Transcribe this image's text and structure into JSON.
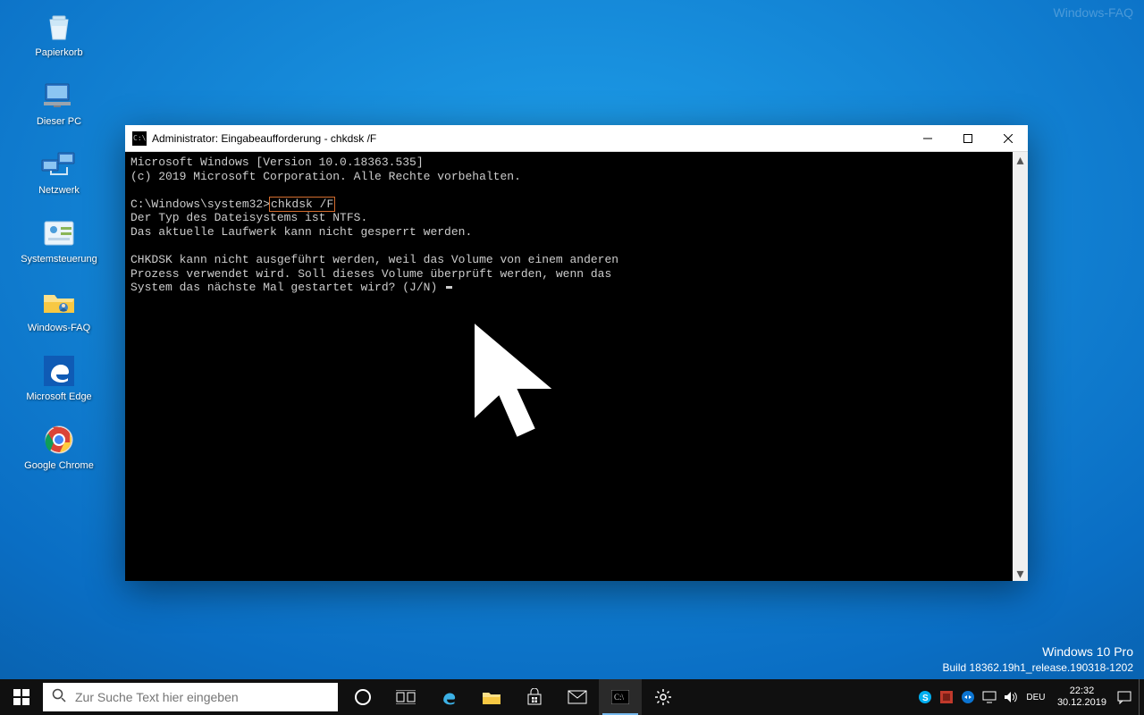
{
  "watermark_top": "Windows-FAQ",
  "watermark_line1": "Windows 10 Pro",
  "watermark_line2": "Build 18362.19h1_release.190318-1202",
  "desktop_icons": [
    {
      "id": "recycle",
      "label": "Papierkorb"
    },
    {
      "id": "pc",
      "label": "Dieser PC"
    },
    {
      "id": "net",
      "label": "Netzwerk"
    },
    {
      "id": "cpl",
      "label": "Systemsteuerung"
    },
    {
      "id": "faq",
      "label": "Windows-FAQ"
    },
    {
      "id": "edge",
      "label": "Microsoft Edge"
    },
    {
      "id": "chrome",
      "label": "Google Chrome"
    }
  ],
  "window": {
    "title": "Administrator: Eingabeaufforderung - chkdsk  /F",
    "lines": {
      "l0": "Microsoft Windows [Version 10.0.18363.535]",
      "l1": "(c) 2019 Microsoft Corporation. Alle Rechte vorbehalten.",
      "l2": "",
      "l3_pre": "C:\\Windows\\system32>",
      "l3_cmd": "chkdsk /F",
      "l4": "Der Typ des Dateisystems ist NTFS.",
      "l5": "Das aktuelle Laufwerk kann nicht gesperrt werden.",
      "l6": "",
      "l7": "CHKDSK kann nicht ausgeführt werden, weil das Volume von einem anderen",
      "l8": "Prozess verwendet wird. Soll dieses Volume überprüft werden, wenn das",
      "l9": "System das nächste Mal gestartet wird? (J/N) "
    }
  },
  "taskbar": {
    "search_placeholder": "Zur Suche Text hier eingeben",
    "clock_time": "22:32",
    "clock_date": "30.12.2019"
  }
}
